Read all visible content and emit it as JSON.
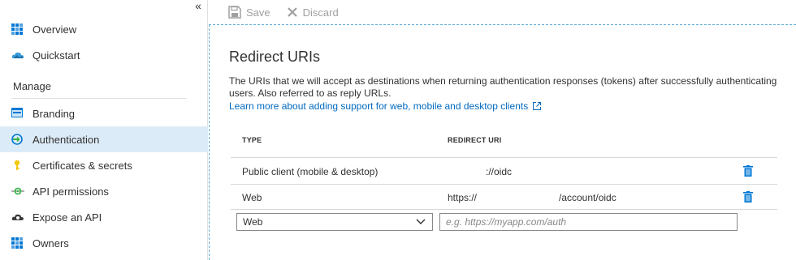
{
  "sidebar": {
    "collapse_label": "«",
    "items": [
      {
        "label": "Overview",
        "icon": "grid-icon"
      },
      {
        "label": "Quickstart",
        "icon": "cloud-icon"
      }
    ],
    "section": "Manage",
    "manage_items": [
      {
        "label": "Branding",
        "icon": "branding-icon"
      },
      {
        "label": "Authentication",
        "icon": "authentication-icon"
      },
      {
        "label": "Certificates & secrets",
        "icon": "key-icon"
      },
      {
        "label": "API permissions",
        "icon": "api-permissions-icon"
      },
      {
        "label": "Expose an API",
        "icon": "cloud-gear-icon"
      },
      {
        "label": "Owners",
        "icon": "grid-icon"
      }
    ],
    "selected": "Authentication"
  },
  "toolbar": {
    "save_label": "Save",
    "discard_label": "Discard"
  },
  "main": {
    "title": "Redirect URIs",
    "description": "The URIs that we will accept as destinations when returning authentication responses (tokens) after successfully authenticating users. Also referred to as reply URLs.",
    "learn_more": "Learn more about adding support for web, mobile and desktop clients",
    "table": {
      "headers": [
        "TYPE",
        "REDIRECT URI"
      ],
      "rows": [
        {
          "type": "Public client (mobile & desktop)",
          "uri": "://oidc"
        },
        {
          "type": "Web",
          "uri_prefix": "https://",
          "uri_suffix": "/account/oidc"
        }
      ],
      "new_row": {
        "type_value": "Web",
        "uri_placeholder": "e.g. https://myapp.com/auth"
      }
    }
  },
  "colors": {
    "accent": "#0078d4",
    "selected_bg": "#dcebf8",
    "link": "#0069c0"
  }
}
